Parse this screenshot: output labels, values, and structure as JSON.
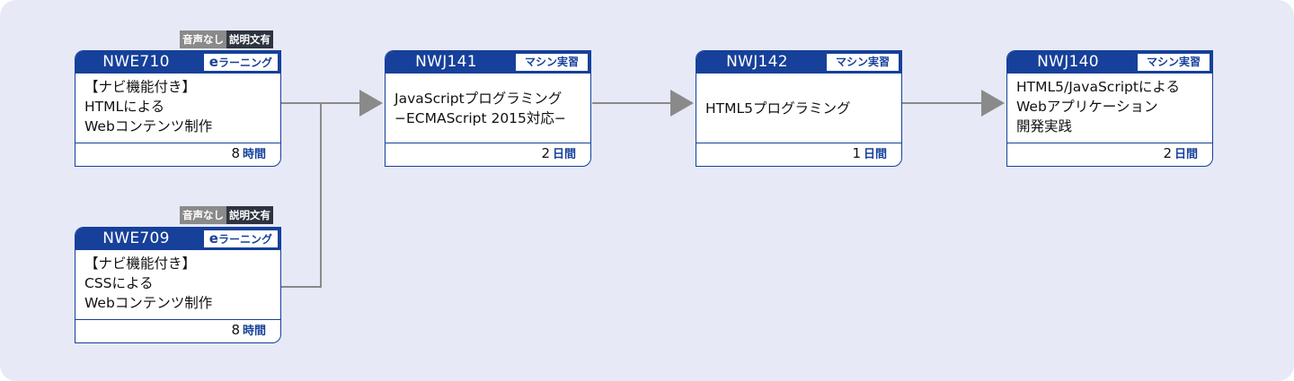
{
  "colors": {
    "navy": "#16409a",
    "background": "#e7e9f6",
    "connector": "#8a8a8a"
  },
  "courses": [
    {
      "code": "NWE710",
      "type": "eラーニング",
      "type_prefix": "e",
      "type_rest": "ラーニング",
      "badge_left": "音声なし",
      "badge_right": "説明文有",
      "title_lines": [
        "【ナビ機能付き】",
        "HTMLによる",
        "Webコンテンツ制作"
      ],
      "duration_value": "8",
      "duration_unit": "時間"
    },
    {
      "code": "NWE709",
      "type": "eラーニング",
      "type_prefix": "e",
      "type_rest": "ラーニング",
      "badge_left": "音声なし",
      "badge_right": "説明文有",
      "title_lines": [
        "【ナビ機能付き】",
        "CSSによる",
        "Webコンテンツ制作"
      ],
      "duration_value": "8",
      "duration_unit": "時間"
    },
    {
      "code": "NWJ141",
      "type": "マシン実習",
      "title_lines": [
        "JavaScriptプログラミング",
        "−ECMAScript 2015対応−"
      ],
      "duration_value": "2",
      "duration_unit": "日間"
    },
    {
      "code": "NWJ142",
      "type": "マシン実習",
      "title_lines": [
        "HTML5プログラミング"
      ],
      "duration_value": "1",
      "duration_unit": "日間"
    },
    {
      "code": "NWJ140",
      "type": "マシン実習",
      "title_lines": [
        "HTML5/JavaScriptによる",
        "Webアプリケーション",
        "開発実践"
      ],
      "duration_value": "2",
      "duration_unit": "日間"
    }
  ]
}
